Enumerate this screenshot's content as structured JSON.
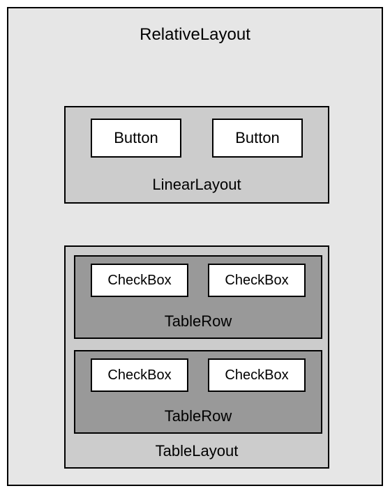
{
  "root": {
    "label": "RelativeLayout"
  },
  "linear": {
    "label": "LinearLayout",
    "buttons": [
      "Button",
      "Button"
    ]
  },
  "table": {
    "label": "TableLayout",
    "rows": [
      {
        "label": "TableRow",
        "cells": [
          "CheckBox",
          "CheckBox"
        ]
      },
      {
        "label": "TableRow",
        "cells": [
          "CheckBox",
          "CheckBox"
        ]
      }
    ]
  }
}
